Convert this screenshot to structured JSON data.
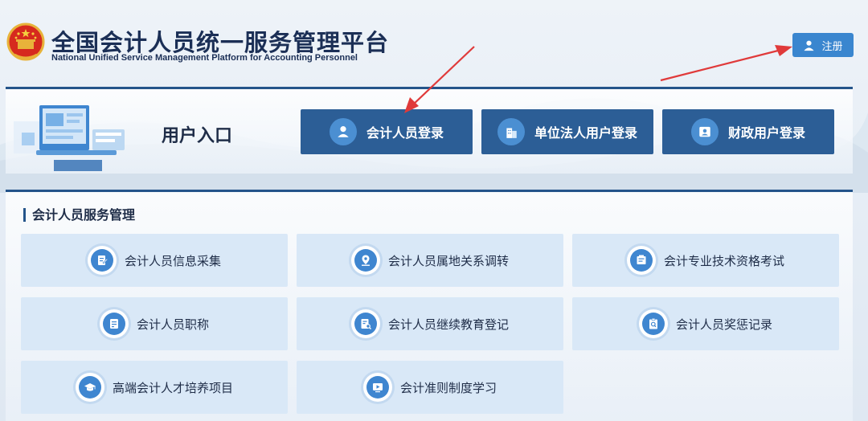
{
  "header": {
    "title_cn": "全国会计人员统一服务管理平台",
    "title_en": "National Unified Service Management Platform for Accounting Personnel",
    "register_label": "注册"
  },
  "entry": {
    "title": "用户入口",
    "buttons": [
      {
        "label": "会计人员登录",
        "icon": "user-icon"
      },
      {
        "label": "单位法人用户登录",
        "icon": "building-icon"
      },
      {
        "label": "财政用户登录",
        "icon": "id-card-icon"
      }
    ]
  },
  "services": {
    "title": "会计人员服务管理",
    "tiles": [
      {
        "label": "会计人员信息采集",
        "icon": "edit-document-icon"
      },
      {
        "label": "会计人员属地关系调转",
        "icon": "location-pin-icon"
      },
      {
        "label": "会计专业技术资格考试",
        "icon": "exam-icon"
      },
      {
        "label": "会计人员职称",
        "icon": "certificate-icon"
      },
      {
        "label": "会计人员继续教育登记",
        "icon": "search-document-icon"
      },
      {
        "label": "会计人员奖惩记录",
        "icon": "clipboard-search-icon"
      },
      {
        "label": "高端会计人才培养项目",
        "icon": "graduation-cap-icon"
      },
      {
        "label": "会计准则制度学习",
        "icon": "play-video-icon"
      }
    ]
  },
  "colors": {
    "primary": "#2c5e96",
    "accent": "#3a86cf",
    "tile_bg": "#d9e8f7",
    "arrow": "#e03a3a"
  }
}
